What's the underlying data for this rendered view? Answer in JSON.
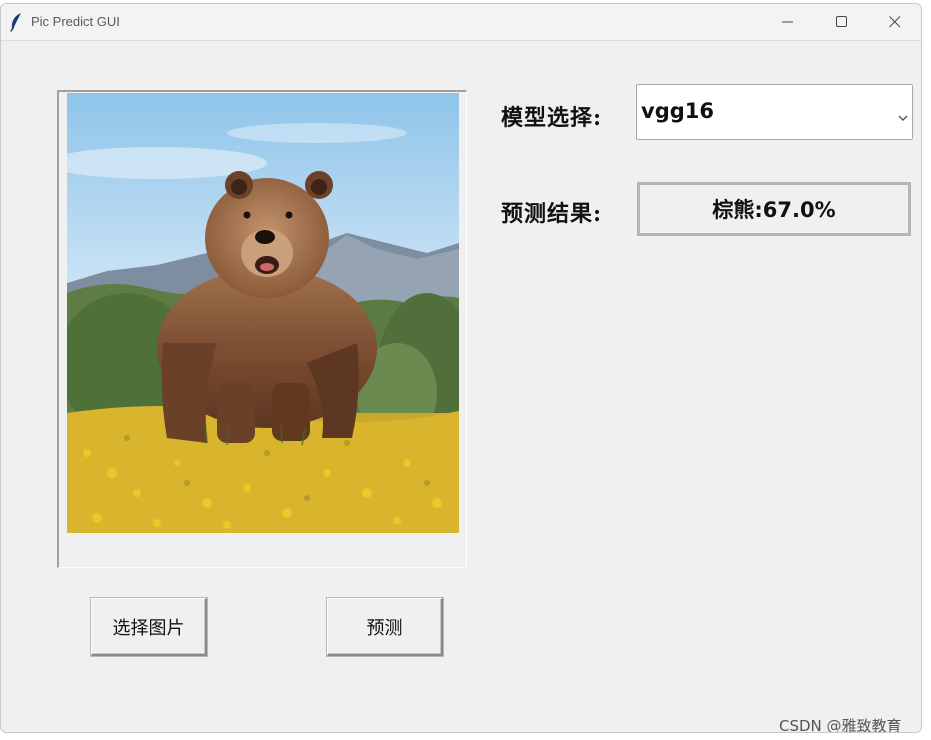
{
  "window": {
    "title": "Pic Predict GUI"
  },
  "form": {
    "model_label": "模型选择:",
    "model_selected": "vgg16",
    "result_label": "预测结果:",
    "result_value": "棕熊:67.0%"
  },
  "buttons": {
    "select_image": "选择图片",
    "predict": "预测"
  },
  "image": {
    "subject": "brown bear in a meadow of yellow flowers"
  },
  "watermark": "CSDN @雅致教育",
  "icons": {
    "app": "feather-icon",
    "minimize": "minimize-icon",
    "maximize": "maximize-icon",
    "close": "close-icon",
    "dropdown": "chevron-down-icon"
  }
}
